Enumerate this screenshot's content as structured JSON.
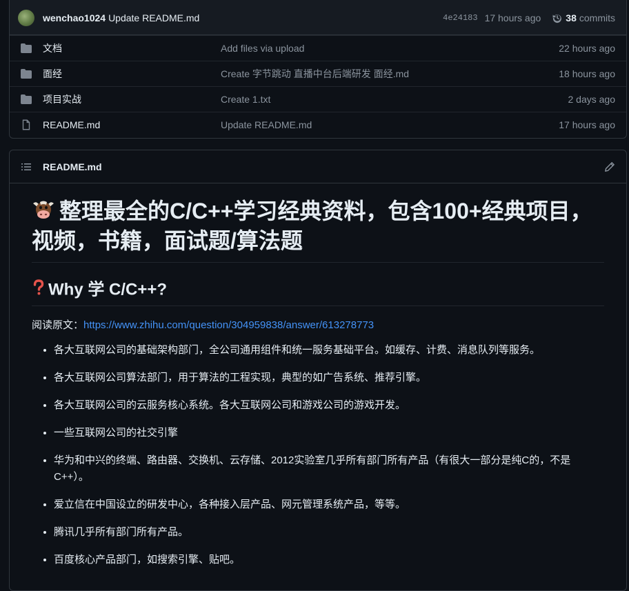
{
  "commit": {
    "author": "wenchao1024",
    "message": "Update README.md",
    "sha": "4e24183",
    "age": "17 hours ago",
    "commit_count": "38",
    "commits_label": "commits"
  },
  "files": [
    {
      "type": "folder",
      "name": "文档",
      "message": "Add files via upload",
      "time": "22 hours ago"
    },
    {
      "type": "folder",
      "name": "面经",
      "message": "Create 字节跳动 直播中台后端研发 面经.md",
      "time": "18 hours ago"
    },
    {
      "type": "folder",
      "name": "项目实战",
      "message": "Create 1.txt",
      "time": "2 days ago"
    },
    {
      "type": "file",
      "name": "README.md",
      "message": "Update README.md",
      "time": "17 hours ago"
    }
  ],
  "readme": {
    "filename": "README.md",
    "h1_line1": "整理最全的C/C++学习经典资料，包含100+经典项目，",
    "h1_line2": "视频，书籍，面试题/算法题",
    "h2": "Why 学 C/C++?",
    "source_label": "阅读原文：",
    "source_url": "https://www.zhihu.com/question/304959838/answer/613278773",
    "items": [
      "各大互联网公司的基础架构部门，全公司通用组件和统一服务基础平台。如缓存、计费、消息队列等服务。",
      "各大互联网公司算法部门，用于算法的工程实现，典型的如广告系统、推荐引擎。",
      "各大互联网公司的云服务核心系统。各大互联网公司和游戏公司的游戏开发。",
      "一些互联网公司的社交引擎",
      "华为和中兴的终端、路由器、交换机、云存储、2012实验室几乎所有部门所有产品（有很大一部分是纯C的，不是C++）。",
      "爱立信在中国设立的研发中心，各种接入层产品、网元管理系统产品，等等。",
      "腾讯几乎所有部门所有产品。",
      "百度核心产品部门，如搜索引擎、贴吧。"
    ]
  },
  "colors": {
    "accent": "#4493f8",
    "folder": "#7d8590",
    "question": "#e5534b"
  }
}
